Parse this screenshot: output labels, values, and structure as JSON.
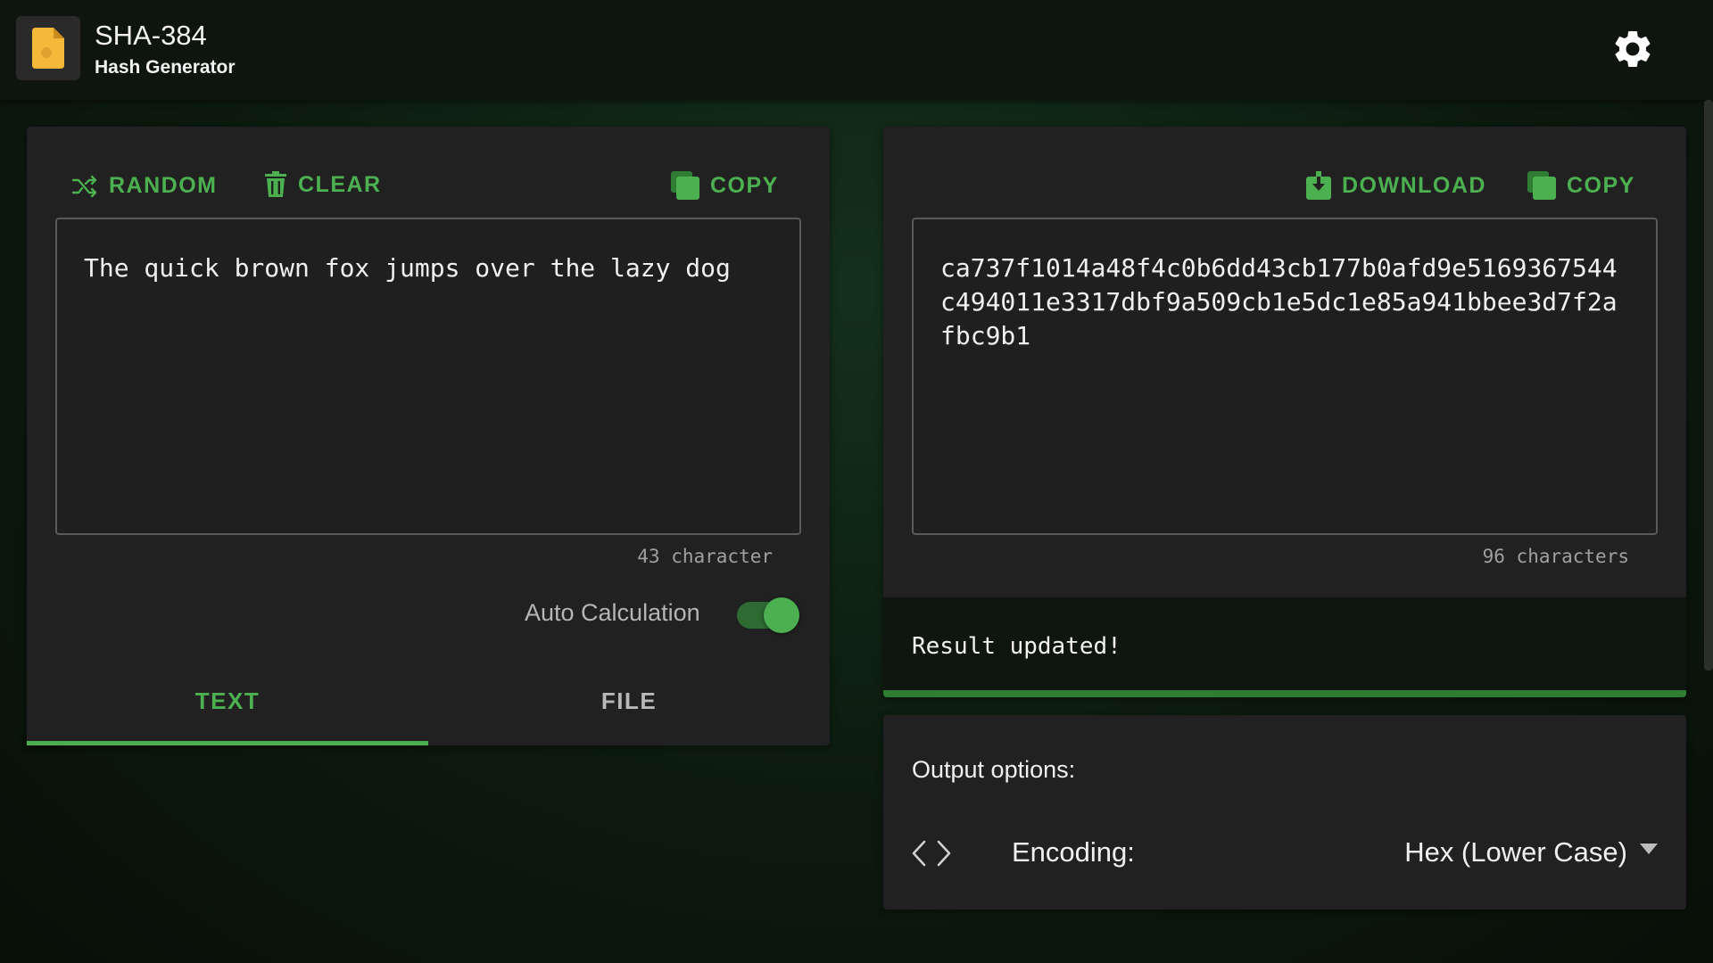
{
  "app": {
    "title": "SHA-384",
    "subtitle": "Hash Generator",
    "icon": "file-document-icon",
    "accent_color": "#4caf50",
    "icon_color": "#f5b93a"
  },
  "input_panel": {
    "random_label": "RANDOM",
    "clear_label": "CLEAR",
    "copy_label": "COPY",
    "text": "The quick brown fox jumps over the lazy dog",
    "char_count": "43 character",
    "auto_calc_label": "Auto Calculation",
    "auto_calc_enabled": true,
    "tabs": [
      {
        "label": "TEXT",
        "active": true
      },
      {
        "label": "FILE",
        "active": false
      }
    ]
  },
  "output_panel": {
    "download_label": "DOWNLOAD",
    "copy_label": "COPY",
    "hash": "ca737f1014a48f4c0b6dd43cb177b0afd9e5169367544c494011e3317dbf9a509cb1e5dc1e85a941bbee3d7f2afbc9b1",
    "char_count": "96 characters",
    "status": "Result updated!"
  },
  "options": {
    "title": "Output options:",
    "encoding_label": "Encoding:",
    "encoding_value": "Hex (Lower Case)"
  }
}
